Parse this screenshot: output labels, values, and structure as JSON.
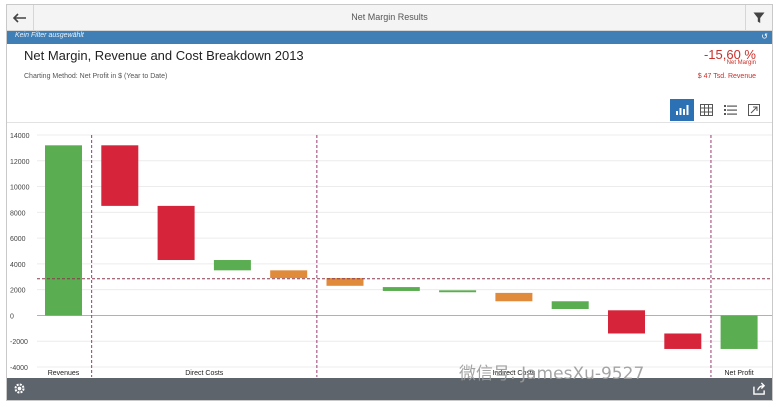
{
  "app": {
    "title": "Net Margin Results",
    "filter_text": "Kein Filter ausgewählt"
  },
  "header": {
    "chart_title": "Net Margin, Revenue and Cost Breakdown 2013",
    "charting_method": "Charting Method: Net Profit in $ (Year to Date)",
    "kpi_value": "-15,60 %",
    "kpi_label": "Net Margin",
    "revenue": "$ 47 Tsd. Revenue"
  },
  "toolbar": {
    "views": [
      "chart-view-icon",
      "table-view-icon",
      "list-view-icon",
      "fullscreen-icon"
    ],
    "active_view": "chart-view-icon"
  },
  "footer": {
    "icons": [
      "gear-icon",
      "share-icon"
    ]
  },
  "watermark": "微信号: JamesXu-9527",
  "colors": {
    "brand_blue": "#3f7fb6",
    "kpi_red": "#c8302a",
    "green": "#5aad50",
    "red": "#d6243a",
    "orange": "#e08a3c"
  },
  "chart_data": {
    "type": "bar",
    "subtype": "waterfall",
    "ylim": [
      -4000,
      14000
    ],
    "yticks": [
      -4000,
      -2000,
      0,
      2000,
      4000,
      6000,
      8000,
      10000,
      12000,
      14000
    ],
    "grid": true,
    "reference_line": 2850,
    "group_labels": [
      "Revenues",
      "Direct Costs",
      "Indirect Costs",
      "Net Profit"
    ],
    "bars": [
      {
        "start": 0,
        "end": 13200,
        "color": "green"
      },
      {
        "start": 13200,
        "end": 8500,
        "color": "red"
      },
      {
        "start": 8500,
        "end": 4300,
        "color": "red"
      },
      {
        "start": 3500,
        "end": 4300,
        "color": "green"
      },
      {
        "start": 3500,
        "end": 2900,
        "color": "orange"
      },
      {
        "start": 2900,
        "end": 2300,
        "color": "orange"
      },
      {
        "start": 1900,
        "end": 2200,
        "color": "green"
      },
      {
        "start": 1800,
        "end": 1950,
        "color": "green"
      },
      {
        "start": 1750,
        "end": 1100,
        "color": "orange"
      },
      {
        "start": 500,
        "end": 1100,
        "color": "green"
      },
      {
        "start": 400,
        "end": -1400,
        "color": "red"
      },
      {
        "start": -1400,
        "end": -2600,
        "color": "red"
      },
      {
        "start": 0,
        "end": -2600,
        "color": "green"
      }
    ]
  }
}
